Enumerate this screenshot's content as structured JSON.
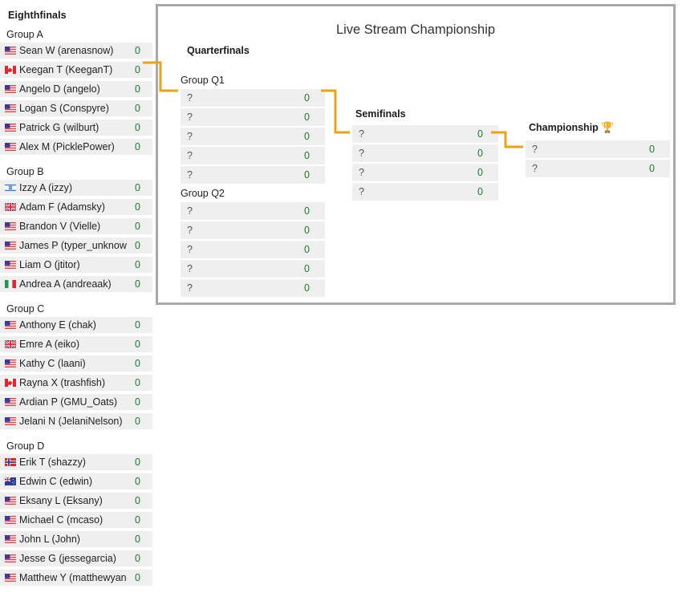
{
  "colors": {
    "connector": "#e8a317",
    "score_green": "#1e7a33",
    "row_bg": "#efefef",
    "panel_border": "#a9a9a9",
    "text": "#222222"
  },
  "eighthfinals": {
    "stage_label": "Eighthfinals",
    "groups": [
      {
        "label": "Group A",
        "players": [
          {
            "flag": "us-flag-icon",
            "name": "Sean W (arenasnow)",
            "score": "0"
          },
          {
            "flag": "ca-flag-icon",
            "name": "Keegan T (KeeganT)",
            "score": "0"
          },
          {
            "flag": "us-flag-icon",
            "name": "Angelo D (angelo)",
            "score": "0"
          },
          {
            "flag": "us-flag-icon",
            "name": "Logan S (Conspyre)",
            "score": "0"
          },
          {
            "flag": "us-flag-icon",
            "name": "Patrick G (wilburt)",
            "score": "0"
          },
          {
            "flag": "us-flag-icon",
            "name": "Alex M (PicklePower)",
            "score": "0"
          }
        ]
      },
      {
        "label": "Group B",
        "players": [
          {
            "flag": "il-flag-icon",
            "name": "Izzy A (izzy)",
            "score": "0"
          },
          {
            "flag": "gb-flag-icon",
            "name": "Adam F (Adamsky)",
            "score": "0"
          },
          {
            "flag": "us-flag-icon",
            "name": "Brandon V (Vielle)",
            "score": "0"
          },
          {
            "flag": "us-flag-icon",
            "name": "James P (typer_unknow",
            "score": "0"
          },
          {
            "flag": "us-flag-icon",
            "name": "Liam O (jtitor)",
            "score": "0"
          },
          {
            "flag": "it-flag-icon",
            "name": "Andrea A (andreaak)",
            "score": "0"
          }
        ]
      },
      {
        "label": "Group C",
        "players": [
          {
            "flag": "us-flag-icon",
            "name": "Anthony E (chak)",
            "score": "0"
          },
          {
            "flag": "gb-flag-icon",
            "name": "Emre A (eiko)",
            "score": "0"
          },
          {
            "flag": "us-flag-icon",
            "name": "Kathy C (laani)",
            "score": "0"
          },
          {
            "flag": "ca-flag-icon",
            "name": "Rayna X (trashfish)",
            "score": "0"
          },
          {
            "flag": "us-flag-icon",
            "name": "Ardian P (GMU_Oats)",
            "score": "0"
          },
          {
            "flag": "us-flag-icon",
            "name": "Jelani N (JelaniNelson)",
            "score": "0"
          }
        ]
      },
      {
        "label": "Group D",
        "players": [
          {
            "flag": "no-flag-icon",
            "name": "Erik T (shazzy)",
            "score": "0"
          },
          {
            "flag": "nz-flag-icon",
            "name": "Edwin C (edwin)",
            "score": "0"
          },
          {
            "flag": "us-flag-icon",
            "name": "Eksany L (Eksany)",
            "score": "0"
          },
          {
            "flag": "us-flag-icon",
            "name": "Michael C (mcaso)",
            "score": "0"
          },
          {
            "flag": "us-flag-icon",
            "name": "John L (John)",
            "score": "0"
          },
          {
            "flag": "us-flag-icon",
            "name": "Jesse G (jessegarcia)",
            "score": "0"
          },
          {
            "flag": "us-flag-icon",
            "name": "Matthew Y (matthewyan",
            "score": "0"
          }
        ]
      }
    ]
  },
  "bracket": {
    "title": "Live Stream Championship",
    "quarterfinals": {
      "stage_label": "Quarterfinals",
      "groups": [
        {
          "label": "Group Q1",
          "rows": [
            {
              "name": "?",
              "score": "0"
            },
            {
              "name": "?",
              "score": "0"
            },
            {
              "name": "?",
              "score": "0"
            },
            {
              "name": "?",
              "score": "0"
            },
            {
              "name": "?",
              "score": "0"
            }
          ]
        },
        {
          "label": "Group Q2",
          "rows": [
            {
              "name": "?",
              "score": "0"
            },
            {
              "name": "?",
              "score": "0"
            },
            {
              "name": "?",
              "score": "0"
            },
            {
              "name": "?",
              "score": "0"
            },
            {
              "name": "?",
              "score": "0"
            }
          ]
        }
      ]
    },
    "semifinals": {
      "stage_label": "Semifinals",
      "rows": [
        {
          "name": "?",
          "score": "0"
        },
        {
          "name": "?",
          "score": "0"
        },
        {
          "name": "?",
          "score": "0"
        },
        {
          "name": "?",
          "score": "0"
        }
      ]
    },
    "championship": {
      "stage_label": "Championship",
      "trophy": "🏆",
      "rows": [
        {
          "name": "?",
          "score": "0"
        },
        {
          "name": "?",
          "score": "0"
        }
      ]
    }
  }
}
